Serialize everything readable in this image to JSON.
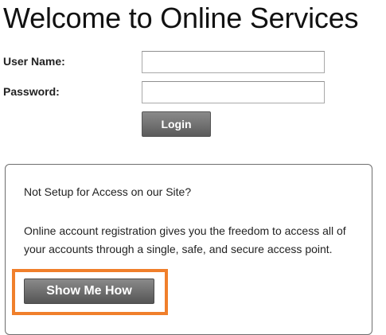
{
  "page": {
    "title": "Welcome to Online Services"
  },
  "login_form": {
    "username_label": "User Name:",
    "username_value": "",
    "password_label": "Password:",
    "password_value": "",
    "login_button": "Login"
  },
  "info_panel": {
    "heading": "Not Setup for Access on our Site?",
    "body": "Online account registration gives you the freedom to access all of your accounts through a single, safe, and secure access point.",
    "button": "Show Me How"
  },
  "colors": {
    "highlight": "#f07f2b",
    "button_gray": "#6b6b6b",
    "panel_border": "#6e6e6e"
  }
}
